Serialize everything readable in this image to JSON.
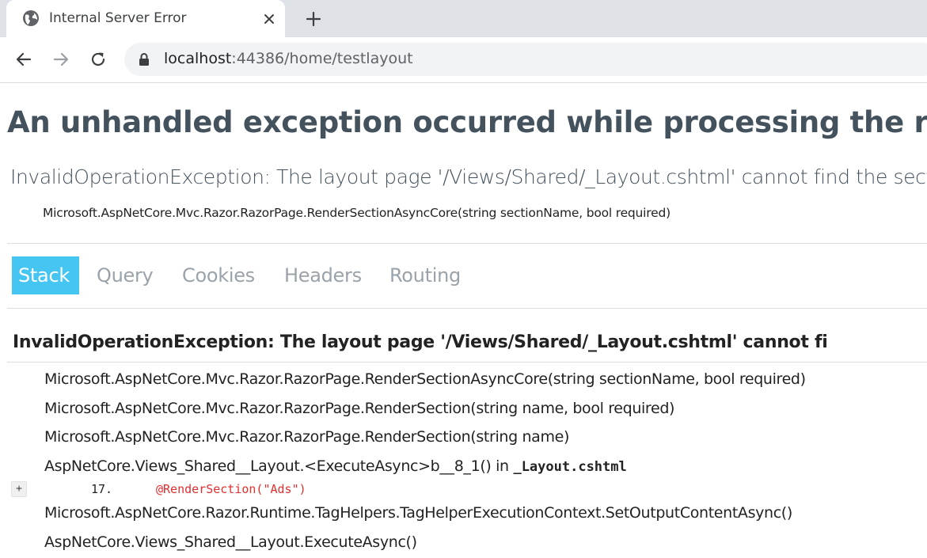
{
  "browser": {
    "tab_title": "Internal Server Error",
    "url_host": "localhost",
    "url_rest": ":44386/home/testlayout",
    "icons": [
      "globe-icon",
      "close-icon",
      "plus-icon",
      "back-icon",
      "forward-icon",
      "reload-icon",
      "lock-icon"
    ]
  },
  "page": {
    "heading": "An unhandled exception occurred while processing the request.",
    "exception_message": "InvalidOperationException: The layout page '/Views/Shared/_Layout.cshtml' cannot find the secti",
    "exception_location": "Microsoft.AspNetCore.Mvc.Razor.RazorPage.RenderSectionAsyncCore(string sectionName, bool required)",
    "tabs": [
      {
        "label": "Stack",
        "active": true
      },
      {
        "label": "Query",
        "active": false
      },
      {
        "label": "Cookies",
        "active": false
      },
      {
        "label": "Headers",
        "active": false
      },
      {
        "label": "Routing",
        "active": false
      }
    ],
    "stack_title": "InvalidOperationException: The layout page '/Views/Shared/_Layout.cshtml' cannot fi",
    "frames": [
      {
        "text": "Microsoft.AspNetCore.Mvc.Razor.RazorPage.RenderSectionAsyncCore(string sectionName, bool required)"
      },
      {
        "text": "Microsoft.AspNetCore.Mvc.Razor.RazorPage.RenderSection(string name, bool required)"
      },
      {
        "text": "Microsoft.AspNetCore.Mvc.Razor.RazorPage.RenderSection(string name)"
      },
      {
        "text": "AspNetCore.Views_Shared__Layout.<ExecuteAsync>b__8_1() in ",
        "file": "_Layout.cshtml"
      },
      {
        "text": "Microsoft.AspNetCore.Razor.Runtime.TagHelpers.TagHelperExecutionContext.SetOutputContentAsync()"
      },
      {
        "text": "AspNetCore.Views_Shared__Layout.ExecuteAsync()"
      }
    ],
    "expander_label": "+",
    "source_line_number": "17.",
    "source_line_code": "@RenderSection(\"Ads\")",
    "colors": {
      "active_tab": "#44c5f2",
      "heading": "#44525e",
      "source_code": "#e03030"
    }
  }
}
